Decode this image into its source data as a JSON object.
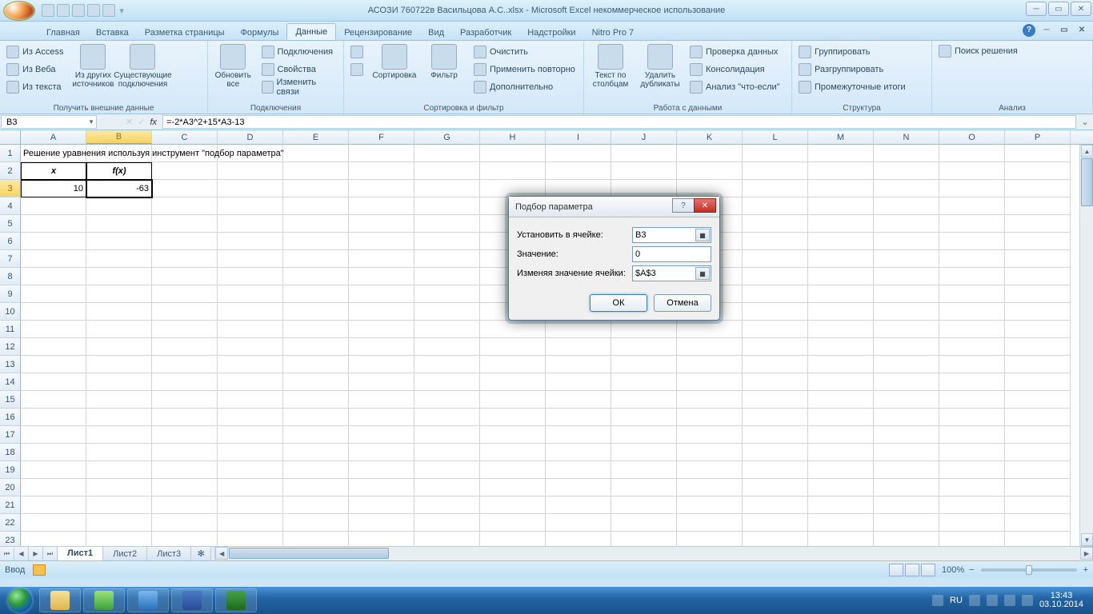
{
  "window": {
    "title": "АСОЗИ 760722в Васильцова А.С..xlsx - Microsoft Excel некоммерческое использование"
  },
  "tabs": {
    "items": [
      "Главная",
      "Вставка",
      "Разметка страницы",
      "Формулы",
      "Данные",
      "Рецензирование",
      "Вид",
      "Разработчик",
      "Надстройки",
      "Nitro Pro 7"
    ],
    "active": 4
  },
  "ribbon": {
    "g1": {
      "label": "Получить внешние данные",
      "access": "Из Access",
      "web": "Из Веба",
      "text": "Из текста",
      "other": "Из других источников",
      "existing": "Существующие подключения"
    },
    "g2": {
      "label": "Подключения",
      "refresh": "Обновить все",
      "conns": "Подключения",
      "props": "Свойства",
      "edit": "Изменить связи"
    },
    "g3": {
      "label": "Сортировка и фильтр",
      "az": "А↓Я",
      "za": "Я↓А",
      "sort": "Сортировка",
      "filter": "Фильтр",
      "clear": "Очистить",
      "reapply": "Применить повторно",
      "adv": "Дополнительно"
    },
    "g4": {
      "label": "Работа с данными",
      "ttc": "Текст по столбцам",
      "dups": "Удалить дубликаты",
      "valid": "Проверка данных",
      "consol": "Консолидация",
      "whatif": "Анализ \"что-если\""
    },
    "g5": {
      "label": "Структура",
      "group": "Группировать",
      "ungroup": "Разгруппировать",
      "subtotal": "Промежуточные итоги"
    },
    "g6": {
      "label": "Анализ",
      "solver": "Поиск решения"
    }
  },
  "formula": {
    "namebox": "B3",
    "value": "=-2*A3^2+15*A3-13"
  },
  "grid": {
    "cols": [
      "A",
      "B",
      "C",
      "D",
      "E",
      "F",
      "G",
      "H",
      "I",
      "J",
      "K",
      "L",
      "M",
      "N",
      "O",
      "P"
    ],
    "rows": 13,
    "sel_col": "B",
    "sel_row": 3,
    "r1_a": "Решение уравнения используя инструмент \"подбор параметра\"",
    "r2_a": "x",
    "r2_b": "f(x)",
    "r3_a": "10",
    "r3_b": "-63"
  },
  "sheets": {
    "items": [
      "Лист1",
      "Лист2",
      "Лист3"
    ],
    "active": 0
  },
  "status": {
    "mode": "Ввод",
    "zoom": "100%"
  },
  "dialog": {
    "title": "Подбор параметра",
    "lbl_set": "Установить в ячейке:",
    "lbl_set_key": "У",
    "lbl_val": "Значение:",
    "lbl_val_key": "З",
    "lbl_chg": "Изменяя значение ячейки:",
    "lbl_chg_key": "И",
    "val_set": "B3",
    "val_val": "0",
    "val_chg": "$A$3",
    "ok": "ОК",
    "cancel": "Отмена"
  },
  "tray": {
    "lang": "RU",
    "time": "13:43",
    "date": "03.10.2014"
  }
}
